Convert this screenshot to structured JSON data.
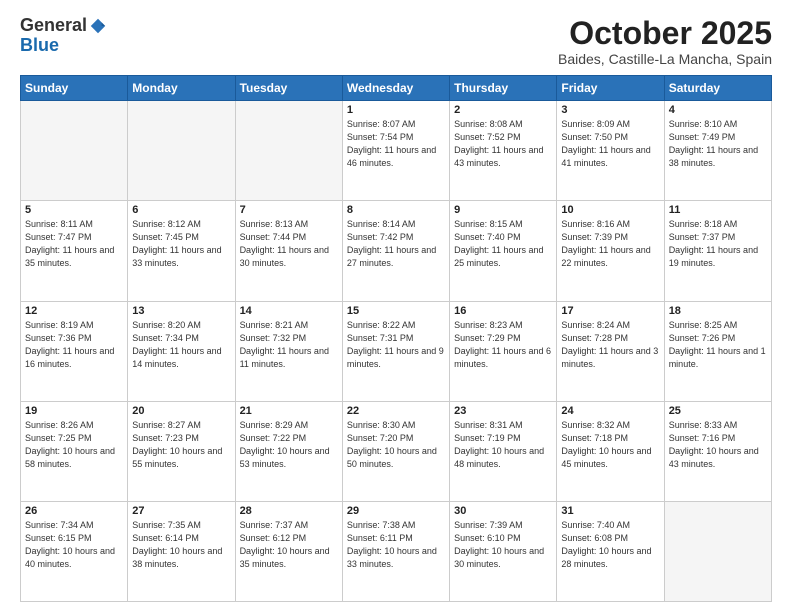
{
  "header": {
    "logo_general": "General",
    "logo_blue": "Blue",
    "month_title": "October 2025",
    "subtitle": "Baides, Castille-La Mancha, Spain"
  },
  "weekdays": [
    "Sunday",
    "Monday",
    "Tuesday",
    "Wednesday",
    "Thursday",
    "Friday",
    "Saturday"
  ],
  "weeks": [
    [
      {
        "day": "",
        "sunrise": "",
        "sunset": "",
        "daylight": ""
      },
      {
        "day": "",
        "sunrise": "",
        "sunset": "",
        "daylight": ""
      },
      {
        "day": "",
        "sunrise": "",
        "sunset": "",
        "daylight": ""
      },
      {
        "day": "1",
        "sunrise": "Sunrise: 8:07 AM",
        "sunset": "Sunset: 7:54 PM",
        "daylight": "Daylight: 11 hours and 46 minutes."
      },
      {
        "day": "2",
        "sunrise": "Sunrise: 8:08 AM",
        "sunset": "Sunset: 7:52 PM",
        "daylight": "Daylight: 11 hours and 43 minutes."
      },
      {
        "day": "3",
        "sunrise": "Sunrise: 8:09 AM",
        "sunset": "Sunset: 7:50 PM",
        "daylight": "Daylight: 11 hours and 41 minutes."
      },
      {
        "day": "4",
        "sunrise": "Sunrise: 8:10 AM",
        "sunset": "Sunset: 7:49 PM",
        "daylight": "Daylight: 11 hours and 38 minutes."
      }
    ],
    [
      {
        "day": "5",
        "sunrise": "Sunrise: 8:11 AM",
        "sunset": "Sunset: 7:47 PM",
        "daylight": "Daylight: 11 hours and 35 minutes."
      },
      {
        "day": "6",
        "sunrise": "Sunrise: 8:12 AM",
        "sunset": "Sunset: 7:45 PM",
        "daylight": "Daylight: 11 hours and 33 minutes."
      },
      {
        "day": "7",
        "sunrise": "Sunrise: 8:13 AM",
        "sunset": "Sunset: 7:44 PM",
        "daylight": "Daylight: 11 hours and 30 minutes."
      },
      {
        "day": "8",
        "sunrise": "Sunrise: 8:14 AM",
        "sunset": "Sunset: 7:42 PM",
        "daylight": "Daylight: 11 hours and 27 minutes."
      },
      {
        "day": "9",
        "sunrise": "Sunrise: 8:15 AM",
        "sunset": "Sunset: 7:40 PM",
        "daylight": "Daylight: 11 hours and 25 minutes."
      },
      {
        "day": "10",
        "sunrise": "Sunrise: 8:16 AM",
        "sunset": "Sunset: 7:39 PM",
        "daylight": "Daylight: 11 hours and 22 minutes."
      },
      {
        "day": "11",
        "sunrise": "Sunrise: 8:18 AM",
        "sunset": "Sunset: 7:37 PM",
        "daylight": "Daylight: 11 hours and 19 minutes."
      }
    ],
    [
      {
        "day": "12",
        "sunrise": "Sunrise: 8:19 AM",
        "sunset": "Sunset: 7:36 PM",
        "daylight": "Daylight: 11 hours and 16 minutes."
      },
      {
        "day": "13",
        "sunrise": "Sunrise: 8:20 AM",
        "sunset": "Sunset: 7:34 PM",
        "daylight": "Daylight: 11 hours and 14 minutes."
      },
      {
        "day": "14",
        "sunrise": "Sunrise: 8:21 AM",
        "sunset": "Sunset: 7:32 PM",
        "daylight": "Daylight: 11 hours and 11 minutes."
      },
      {
        "day": "15",
        "sunrise": "Sunrise: 8:22 AM",
        "sunset": "Sunset: 7:31 PM",
        "daylight": "Daylight: 11 hours and 9 minutes."
      },
      {
        "day": "16",
        "sunrise": "Sunrise: 8:23 AM",
        "sunset": "Sunset: 7:29 PM",
        "daylight": "Daylight: 11 hours and 6 minutes."
      },
      {
        "day": "17",
        "sunrise": "Sunrise: 8:24 AM",
        "sunset": "Sunset: 7:28 PM",
        "daylight": "Daylight: 11 hours and 3 minutes."
      },
      {
        "day": "18",
        "sunrise": "Sunrise: 8:25 AM",
        "sunset": "Sunset: 7:26 PM",
        "daylight": "Daylight: 11 hours and 1 minute."
      }
    ],
    [
      {
        "day": "19",
        "sunrise": "Sunrise: 8:26 AM",
        "sunset": "Sunset: 7:25 PM",
        "daylight": "Daylight: 10 hours and 58 minutes."
      },
      {
        "day": "20",
        "sunrise": "Sunrise: 8:27 AM",
        "sunset": "Sunset: 7:23 PM",
        "daylight": "Daylight: 10 hours and 55 minutes."
      },
      {
        "day": "21",
        "sunrise": "Sunrise: 8:29 AM",
        "sunset": "Sunset: 7:22 PM",
        "daylight": "Daylight: 10 hours and 53 minutes."
      },
      {
        "day": "22",
        "sunrise": "Sunrise: 8:30 AM",
        "sunset": "Sunset: 7:20 PM",
        "daylight": "Daylight: 10 hours and 50 minutes."
      },
      {
        "day": "23",
        "sunrise": "Sunrise: 8:31 AM",
        "sunset": "Sunset: 7:19 PM",
        "daylight": "Daylight: 10 hours and 48 minutes."
      },
      {
        "day": "24",
        "sunrise": "Sunrise: 8:32 AM",
        "sunset": "Sunset: 7:18 PM",
        "daylight": "Daylight: 10 hours and 45 minutes."
      },
      {
        "day": "25",
        "sunrise": "Sunrise: 8:33 AM",
        "sunset": "Sunset: 7:16 PM",
        "daylight": "Daylight: 10 hours and 43 minutes."
      }
    ],
    [
      {
        "day": "26",
        "sunrise": "Sunrise: 7:34 AM",
        "sunset": "Sunset: 6:15 PM",
        "daylight": "Daylight: 10 hours and 40 minutes."
      },
      {
        "day": "27",
        "sunrise": "Sunrise: 7:35 AM",
        "sunset": "Sunset: 6:14 PM",
        "daylight": "Daylight: 10 hours and 38 minutes."
      },
      {
        "day": "28",
        "sunrise": "Sunrise: 7:37 AM",
        "sunset": "Sunset: 6:12 PM",
        "daylight": "Daylight: 10 hours and 35 minutes."
      },
      {
        "day": "29",
        "sunrise": "Sunrise: 7:38 AM",
        "sunset": "Sunset: 6:11 PM",
        "daylight": "Daylight: 10 hours and 33 minutes."
      },
      {
        "day": "30",
        "sunrise": "Sunrise: 7:39 AM",
        "sunset": "Sunset: 6:10 PM",
        "daylight": "Daylight: 10 hours and 30 minutes."
      },
      {
        "day": "31",
        "sunrise": "Sunrise: 7:40 AM",
        "sunset": "Sunset: 6:08 PM",
        "daylight": "Daylight: 10 hours and 28 minutes."
      },
      {
        "day": "",
        "sunrise": "",
        "sunset": "",
        "daylight": ""
      }
    ]
  ]
}
